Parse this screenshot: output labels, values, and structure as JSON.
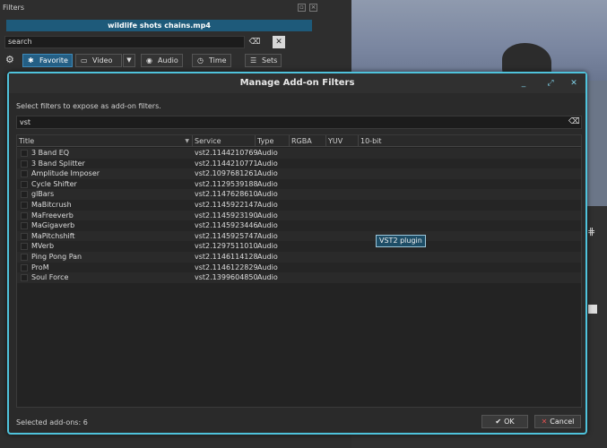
{
  "filters_panel": {
    "title": "Filters",
    "file_name": "wildlife shots chains.mp4",
    "search_value": "search",
    "tabs": [
      {
        "label": "Favorite",
        "icon": "star-icon",
        "active": true
      },
      {
        "label": "Video",
        "icon": "monitor-icon",
        "active": false
      },
      {
        "label": "Audio",
        "icon": "speaker-icon",
        "active": false
      },
      {
        "label": "Time",
        "icon": "clock-icon",
        "active": false
      },
      {
        "label": "Sets",
        "icon": "stack-icon",
        "active": false
      }
    ]
  },
  "dialog": {
    "title": "Manage Add-on Filters",
    "description": "Select filters to expose as add-on filters.",
    "filter_value": "vst",
    "columns": [
      "Title",
      "Service",
      "Type",
      "RGBA",
      "YUV",
      "10-bit"
    ],
    "rows": [
      {
        "title": "3 Band EQ",
        "service": "vst2.1144210769",
        "type": "Audio"
      },
      {
        "title": "3 Band Splitter",
        "service": "vst2.1144210771",
        "type": "Audio"
      },
      {
        "title": "Amplitude Imposer",
        "service": "vst2.1097681261",
        "type": "Audio"
      },
      {
        "title": "Cycle Shifter",
        "service": "vst2.1129539188",
        "type": "Audio"
      },
      {
        "title": "glBars",
        "service": "vst2.1147628610",
        "type": "Audio"
      },
      {
        "title": "MaBitcrush",
        "service": "vst2.1145922147",
        "type": "Audio"
      },
      {
        "title": "MaFreeverb",
        "service": "vst2.1145923190",
        "type": "Audio"
      },
      {
        "title": "MaGigaverb",
        "service": "vst2.1145923446",
        "type": "Audio"
      },
      {
        "title": "MaPitchshift",
        "service": "vst2.1145925747",
        "type": "Audio"
      },
      {
        "title": "MVerb",
        "service": "vst2.1297511010",
        "type": "Audio"
      },
      {
        "title": "Ping Pong Pan",
        "service": "vst2.1146114128",
        "type": "Audio"
      },
      {
        "title": "ProM",
        "service": "vst2.1146122829",
        "type": "Audio"
      },
      {
        "title": "Soul Force",
        "service": "vst2.1399604850",
        "type": "Audio"
      }
    ],
    "tooltip": "VST2 plugin",
    "selected_count": "Selected add-ons: 6",
    "ok_label": "OK",
    "cancel_label": "Cancel"
  },
  "colors": {
    "accent": "#4fc3dc",
    "active_tab": "#245f85",
    "banner": "#1e5a7a",
    "cancel_icon": "#e05050"
  }
}
